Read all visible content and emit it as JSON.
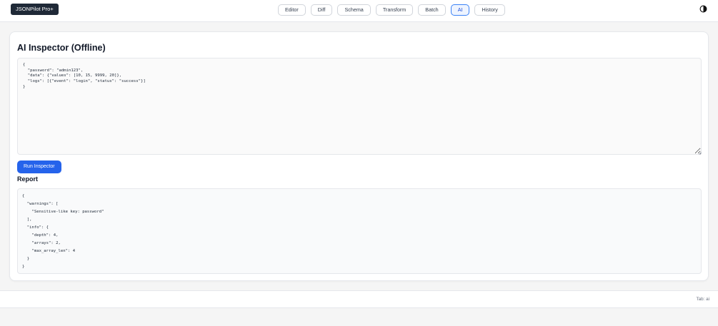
{
  "app": {
    "brand": "JSONPilot Pro+"
  },
  "nav": {
    "tabs": [
      {
        "label": "Editor"
      },
      {
        "label": "Diff"
      },
      {
        "label": "Schema"
      },
      {
        "label": "Transform"
      },
      {
        "label": "Batch"
      },
      {
        "label": "AI",
        "active": true
      },
      {
        "label": "History"
      }
    ]
  },
  "header": {
    "theme_toggle_icon": "contrast-icon"
  },
  "inspector": {
    "title": "AI Inspector (Offline)",
    "input_json": "{\n  \"password\": \"admin123\",\n  \"data\": {\"values\": [10, 15, 9999, 20]},\n  \"logs\": [{\"event\": \"login\", \"status\": \"success\"}]\n}",
    "run_label": "Run Inspector",
    "report_heading": "Report",
    "report_output": "{\n  \"warnings\": [\n    \"Sensitive-like key: password\"\n  ],\n  \"info\": {\n    \"depth\": 4,\n    \"arrays\": 2,\n    \"max_array_len\": 4\n  }\n}"
  },
  "footer": {
    "status": "Tab: ai"
  },
  "colors": {
    "primary": "#2563eb",
    "brand_bg": "#1f2937",
    "active_tab_border": "#3b82f6"
  }
}
